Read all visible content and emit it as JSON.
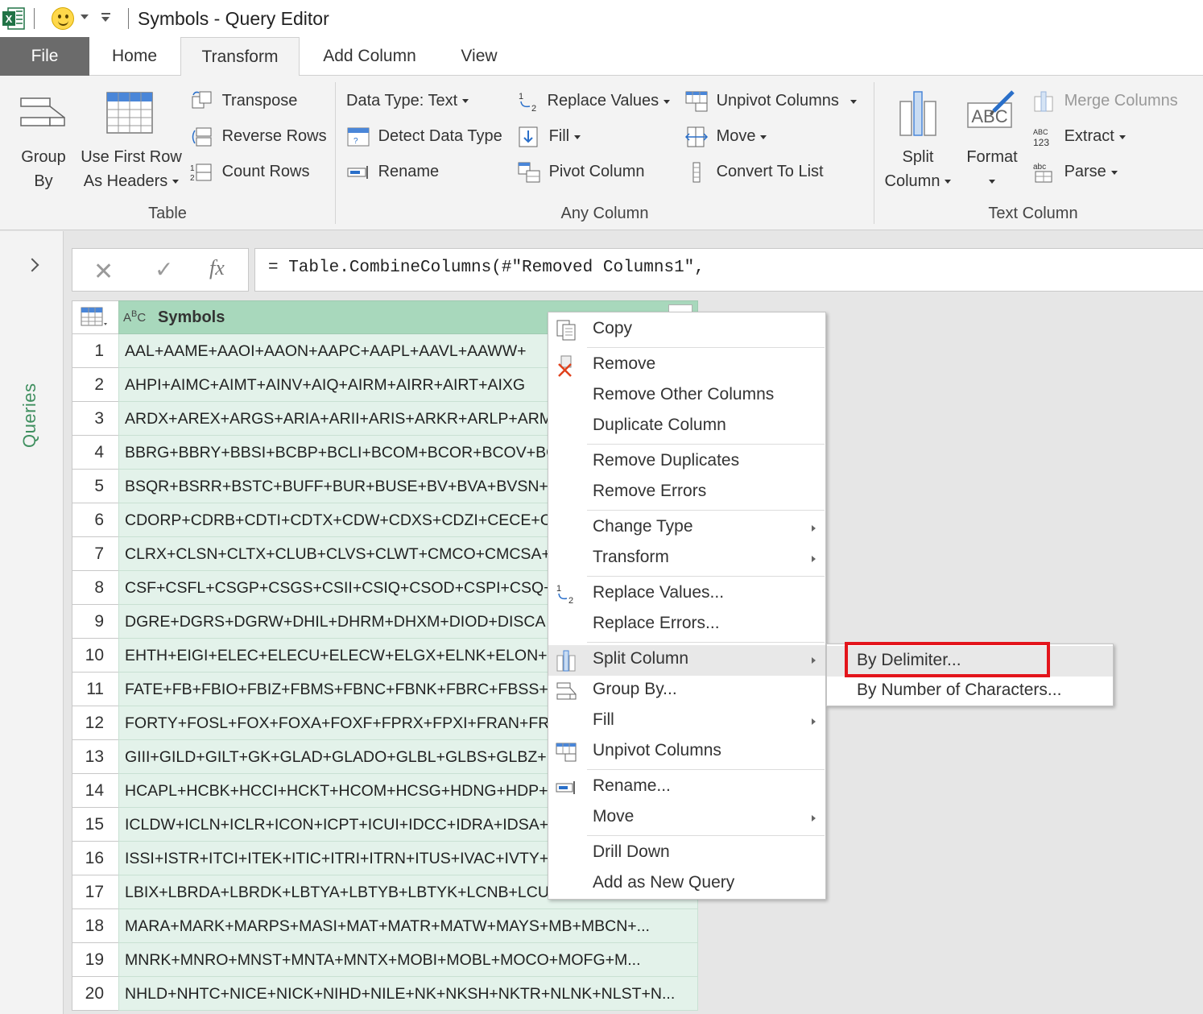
{
  "window": {
    "title": "Symbols - Query Editor"
  },
  "tabs": {
    "file": "File",
    "home": "Home",
    "transform": "Transform",
    "add_column": "Add Column",
    "view": "View"
  },
  "ribbon": {
    "table_group": {
      "label": "Table",
      "group_by_line1": "Group",
      "group_by_line2": "By",
      "use_first_row_line1": "Use First Row",
      "use_first_row_line2": "As Headers",
      "transpose": "Transpose",
      "reverse_rows": "Reverse Rows",
      "count_rows": "Count Rows"
    },
    "any_column_group": {
      "label": "Any Column",
      "data_type": "Data Type: Text",
      "detect_data_type": "Detect Data Type",
      "rename": "Rename",
      "replace_values": "Replace Values",
      "fill": "Fill",
      "pivot_column": "Pivot Column",
      "unpivot_columns": "Unpivot Columns",
      "move": "Move",
      "convert_to_list": "Convert To List"
    },
    "text_column_group": {
      "label": "Text Column",
      "split_column_line1": "Split",
      "split_column_line2": "Column",
      "format": "Format",
      "merge_columns": "Merge Columns",
      "extract": "Extract",
      "parse": "Parse"
    }
  },
  "left_pane": {
    "queries_label": "Queries"
  },
  "formula_bar": {
    "formula": "= Table.CombineColumns(#\"Removed Columns1\","
  },
  "grid": {
    "column_type": "ABC",
    "column_name": "Symbols",
    "rows": [
      {
        "num": "1",
        "value": "AAL+AAME+AAOI+AAON+AAPC+AAPL+AAVL+AAWW+"
      },
      {
        "num": "2",
        "value": "AHPI+AIMC+AIMT+AINV+AIQ+AIRM+AIRR+AIRT+AIXG"
      },
      {
        "num": "3",
        "value": "ARDX+AREX+ARGS+ARIA+ARII+ARIS+ARKR+ARLP+ARM"
      },
      {
        "num": "4",
        "value": "BBRG+BBRY+BBSI+BCBP+BCLI+BCOM+BCOR+BCOV+BC"
      },
      {
        "num": "5",
        "value": "BSQR+BSRR+BSTC+BUFF+BUR+BUSE+BV+BVA+BVSN+BV"
      },
      {
        "num": "6",
        "value": "CDORP+CDRB+CDTI+CDTX+CDW+CDXS+CDZI+CECE+CE"
      },
      {
        "num": "7",
        "value": "CLRX+CLSN+CLTX+CLUB+CLVS+CLWT+CMCO+CMCSA+"
      },
      {
        "num": "8",
        "value": "CSF+CSFL+CSGP+CSGS+CSII+CSIQ+CSOD+CSPI+CSQ+CS"
      },
      {
        "num": "9",
        "value": "DGRE+DGRS+DGRW+DHIL+DHRM+DHXM+DIOD+DISCA"
      },
      {
        "num": "10",
        "value": "EHTH+EIGI+ELEC+ELECU+ELECW+ELGX+ELNK+ELON+E"
      },
      {
        "num": "11",
        "value": "FATE+FB+FBIO+FBIZ+FBMS+FBNC+FBNK+FBRC+FBSS+F"
      },
      {
        "num": "12",
        "value": "FORTY+FOSL+FOX+FOXA+FOXF+FPRX+FPXI+FRAN+FRE"
      },
      {
        "num": "13",
        "value": "GIII+GILD+GILT+GK+GLAD+GLADO+GLBL+GLBS+GLBZ+"
      },
      {
        "num": "14",
        "value": "HCAPL+HCBK+HCCI+HCKT+HCOM+HCSG+HDNG+HDP+"
      },
      {
        "num": "15",
        "value": "ICLDW+ICLN+ICLR+ICON+ICPT+ICUI+IDCC+IDRA+IDSA+"
      },
      {
        "num": "16",
        "value": "ISSI+ISTR+ITCI+ITEK+ITIC+ITRI+ITRN+ITUS+IVAC+IVTY+"
      },
      {
        "num": "17",
        "value": "LBIX+LBRDA+LBRDK+LBTYA+LBTYB+LBTYK+LCNB+LCUT"
      },
      {
        "num": "18",
        "value": "MARA+MARK+MARPS+MASI+MAT+MATR+MATW+MAYS+MB+MBCN+..."
      },
      {
        "num": "19",
        "value": "MNRK+MNRO+MNST+MNTA+MNTX+MOBI+MOBL+MOCO+MOFG+M..."
      },
      {
        "num": "20",
        "value": "NHLD+NHTC+NICE+NICK+NIHD+NILE+NK+NKSH+NKTR+NLNK+NLST+N..."
      }
    ]
  },
  "context_menu": {
    "copy": "Copy",
    "remove": "Remove",
    "remove_other_columns": "Remove Other Columns",
    "duplicate_column": "Duplicate Column",
    "remove_duplicates": "Remove Duplicates",
    "remove_errors": "Remove Errors",
    "change_type": "Change Type",
    "transform": "Transform",
    "replace_values": "Replace Values...",
    "replace_errors": "Replace Errors...",
    "split_column": "Split Column",
    "group_by": "Group By...",
    "fill": "Fill",
    "unpivot_columns": "Unpivot Columns",
    "rename": "Rename...",
    "move": "Move",
    "drill_down": "Drill Down",
    "add_as_new_query": "Add as New Query"
  },
  "submenu": {
    "by_delimiter": "By Delimiter...",
    "by_number_of_characters": "By Number of Characters..."
  },
  "colors": {
    "header_green": "#a8d8bc",
    "cell_green": "#e3f2ea",
    "highlight_red": "#e3141b",
    "queries_green": "#3f8f5f"
  }
}
